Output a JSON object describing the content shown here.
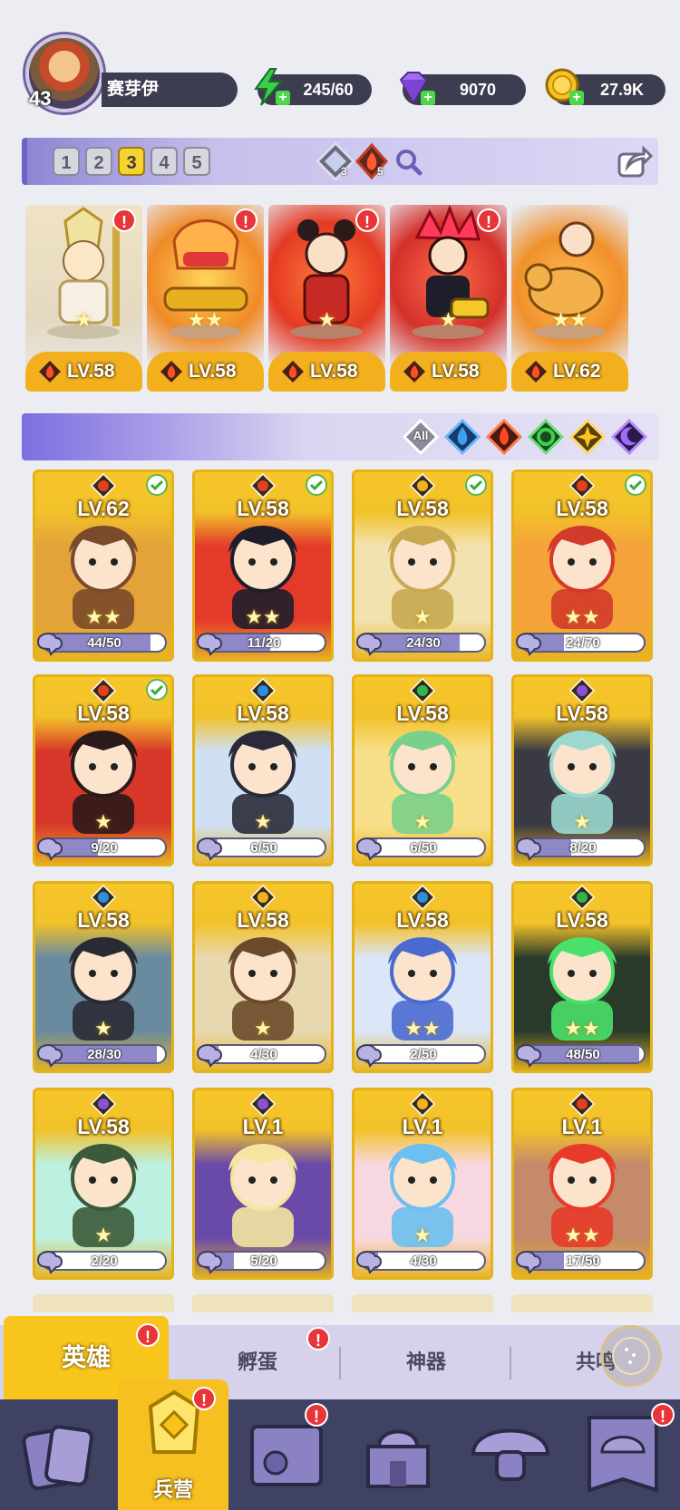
{
  "profile": {
    "level": "43",
    "name": "赛芽伊"
  },
  "resources": [
    {
      "name": "energy",
      "value": "245/60",
      "icon": "lightning-icon",
      "color": "#39d04a"
    },
    {
      "name": "gems",
      "value": "9070",
      "icon": "gem-icon",
      "color": "#8a52d8"
    },
    {
      "name": "gold",
      "value": "27.9K",
      "icon": "coin-icon",
      "color": "#f2b21c"
    }
  ],
  "team": {
    "pages": [
      "1",
      "2",
      "3",
      "4",
      "5"
    ],
    "active_page": "3",
    "counts": {
      "light": "3",
      "fire": "5"
    }
  },
  "team_slots": [
    {
      "level": "LV.58",
      "stars": "★",
      "alert": "!"
    },
    {
      "level": "LV.58",
      "stars": "★★",
      "alert": "!"
    },
    {
      "level": "LV.58",
      "stars": "★",
      "alert": "!"
    },
    {
      "level": "LV.58",
      "stars": "★",
      "alert": "!"
    },
    {
      "level": "LV.62",
      "stars": "★★",
      "alert": "!"
    }
  ],
  "filters": {
    "all": "All"
  },
  "heroes": [
    {
      "level": "LV.62",
      "element": "fire",
      "checked": true,
      "progress": "44/50",
      "fill": 0.88,
      "stars": "★★"
    },
    {
      "level": "LV.58",
      "element": "fire",
      "checked": true,
      "progress": "11/20",
      "fill": 0.55,
      "stars": "★★"
    },
    {
      "level": "LV.58",
      "element": "light",
      "checked": true,
      "progress": "24/30",
      "fill": 0.8,
      "stars": "★"
    },
    {
      "level": "LV.58",
      "element": "fire",
      "checked": true,
      "progress": "24/70",
      "fill": 0.34,
      "stars": "★★"
    },
    {
      "level": "LV.58",
      "element": "fire",
      "checked": true,
      "progress": "9/20",
      "fill": 0.45,
      "stars": "★"
    },
    {
      "level": "LV.58",
      "element": "water",
      "checked": false,
      "progress": "6/50",
      "fill": 0.12,
      "stars": "★"
    },
    {
      "level": "LV.58",
      "element": "nature",
      "checked": false,
      "progress": "6/50",
      "fill": 0.12,
      "stars": "★"
    },
    {
      "level": "LV.58",
      "element": "dark",
      "checked": false,
      "progress": "8/20",
      "fill": 0.4,
      "stars": "★"
    },
    {
      "level": "LV.58",
      "element": "water",
      "checked": false,
      "progress": "28/30",
      "fill": 0.93,
      "stars": "★"
    },
    {
      "level": "LV.58",
      "element": "light",
      "checked": false,
      "progress": "4/30",
      "fill": 0.13,
      "stars": "★"
    },
    {
      "level": "LV.58",
      "element": "water",
      "checked": false,
      "progress": "2/50",
      "fill": 0.04,
      "stars": "★★"
    },
    {
      "level": "LV.58",
      "element": "nature",
      "checked": false,
      "progress": "48/50",
      "fill": 0.96,
      "stars": "★★"
    },
    {
      "level": "LV.58",
      "element": "dark",
      "checked": false,
      "progress": "2/20",
      "fill": 0.1,
      "stars": "★"
    },
    {
      "level": "LV.1",
      "element": "dark",
      "checked": false,
      "progress": "5/20",
      "fill": 0.25,
      "stars": ""
    },
    {
      "level": "LV.1",
      "element": "light",
      "checked": false,
      "progress": "4/30",
      "fill": 0.13,
      "stars": "★"
    },
    {
      "level": "LV.1",
      "element": "fire",
      "checked": false,
      "progress": "17/50",
      "fill": 0.34,
      "stars": "★★"
    }
  ],
  "element_colors": {
    "fire": "#e2401f",
    "water": "#2a8fe0",
    "nature": "#2db84a",
    "light": "#f2b21c",
    "dark": "#8a52d8"
  },
  "subtabs": [
    "英雄",
    "孵蛋",
    "神器",
    "共鸣"
  ],
  "subtab_alerts": {
    "hero": "!",
    "egg": "!"
  },
  "nav": {
    "active_label": "兵营",
    "items": [
      "cards-icon",
      "barracks-icon",
      "map-icon",
      "castle-icon",
      "mushroom-icon",
      "mushroom-banner-icon"
    ]
  }
}
